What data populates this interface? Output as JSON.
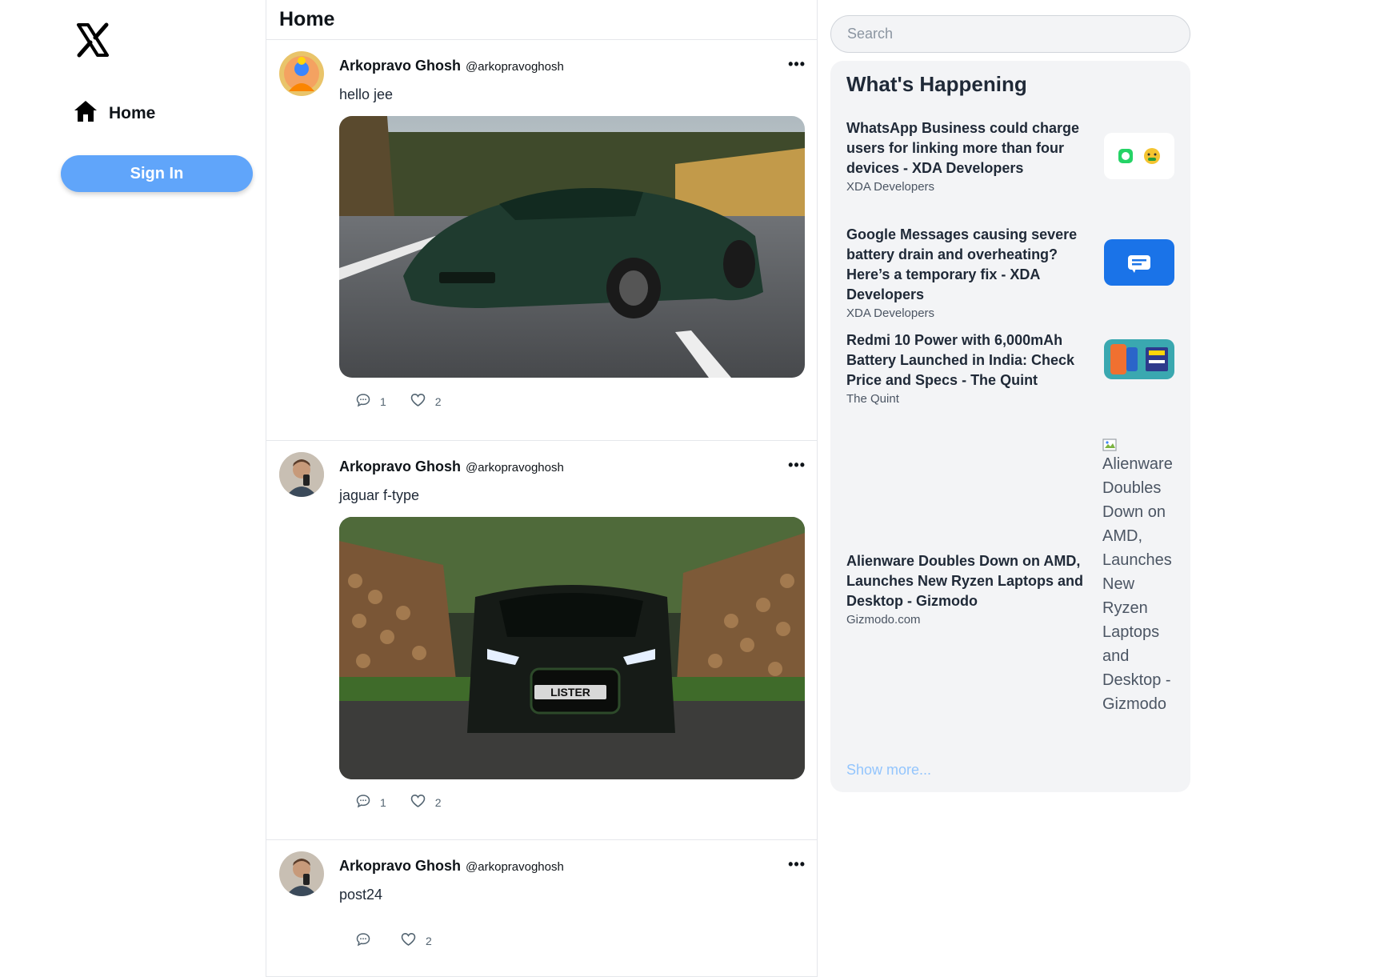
{
  "sidebar": {
    "logo_icon": "x-logo-icon",
    "nav": [
      {
        "label": "Home",
        "icon": "home-icon"
      }
    ],
    "signin_label": "Sign In"
  },
  "feed": {
    "title": "Home",
    "posts": [
      {
        "name": "Arkopravo Ghosh",
        "handle": "@arkopravoghosh",
        "text": "hello jee",
        "image": "green sports car on road",
        "comments": "1",
        "likes": "2"
      },
      {
        "name": "Arkopravo Ghosh",
        "handle": "@arkopravoghosh",
        "text": "jaguar f-type",
        "image": "dark SUV between log piles",
        "comments": "1",
        "likes": "2"
      },
      {
        "name": "Arkopravo Ghosh",
        "handle": "@arkopravoghosh",
        "text": "post24",
        "comments": "",
        "likes": "2"
      }
    ]
  },
  "right": {
    "search_placeholder": "Search",
    "title": "What's Happening",
    "news": [
      {
        "title": "WhatsApp Business could charge users for linking more than four devices - XDA Developers",
        "source": "XDA Developers"
      },
      {
        "title": "Google Messages causing severe battery drain and overheating? Here’s a temporary fix - XDA Developers",
        "source": "XDA Developers"
      },
      {
        "title": "Redmi 10 Power with 6,000mAh Battery Launched in India: Check Price and Specs - The Quint",
        "source": "The Quint"
      },
      {
        "title": "Alienware Doubles Down on AMD, Launches New Ryzen Laptops and Desktop - Gizmodo",
        "source": "Gizmodo.com",
        "alt": "Alienware Doubles Down on AMD, Launches New Ryzen Laptops and Desktop - Gizmodo"
      }
    ],
    "show_more": "Show more..."
  },
  "colors": {
    "accent": "#60a5fa",
    "panel": "#f3f4f6",
    "link_light": "#93c5fd"
  }
}
